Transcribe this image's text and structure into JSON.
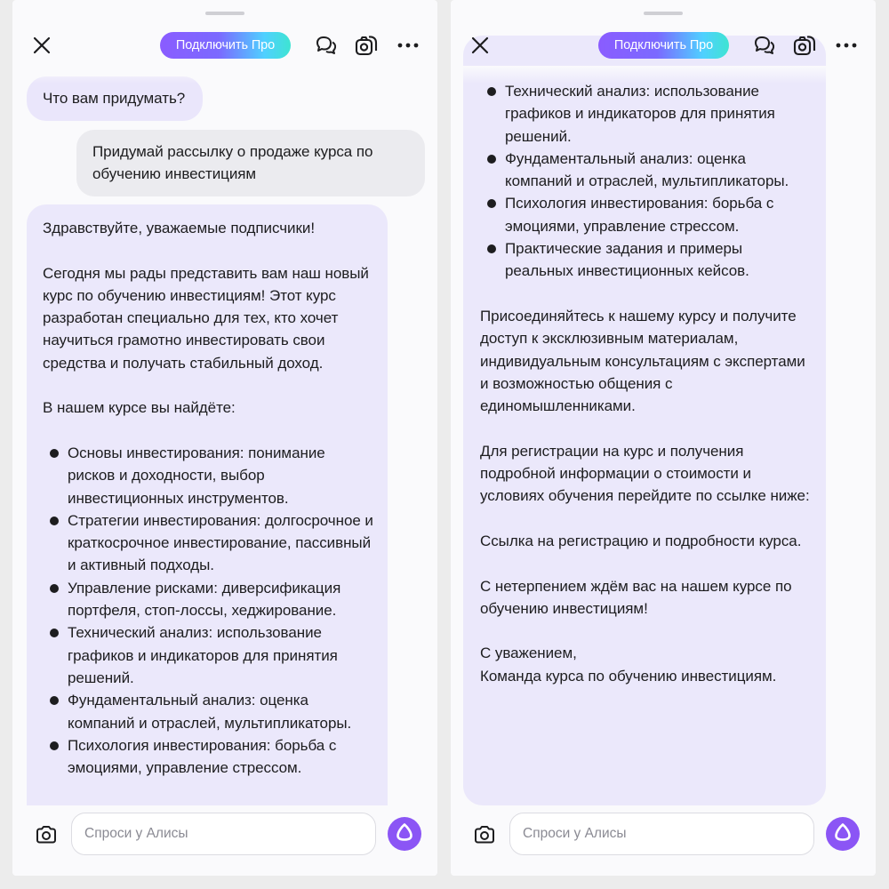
{
  "header": {
    "pro_button_label": "Подключить Про"
  },
  "input": {
    "placeholder": "Спроси у Алисы"
  },
  "left": {
    "alice_greeting": "Что вам придумать?",
    "user_message": "Придумай рассылку о продаже курса по обучению инвестициям",
    "reply": {
      "p1": "Здравствуйте, уважаемые подписчики!",
      "p2": "Сегодня мы рады представить вам наш новый курс по обучению инвестициям! Этот курс разработан специально для тех, кто хочет научиться грамотно инвестировать свои средства и получать стабильный доход.",
      "p3": "В нашем курсе вы найдёте:",
      "bullets": [
        "Основы инвестирования: понимание рисков и доходности, выбор инвестиционных инструментов.",
        "Стратегии инвестирования: долгосрочное и краткосрочное инвестирование, пассивный и активный подходы.",
        "Управление рисками: диверсификация портфеля, стоп-лоссы, хеджирование.",
        "Технический анализ: использование графиков и индикаторов для принятия решений.",
        "Фундаментальный анализ: оценка компаний и отраслей, мультипликаторы.",
        "Психология инвестирования: борьба с эмоциями, управление стрессом."
      ]
    }
  },
  "right": {
    "bullets": [
      "Технический анализ: использование графиков и индикаторов для принятия решений.",
      "Фундаментальный анализ: оценка компаний и отраслей, мультипликаторы.",
      "Психология инвестирования: борьба с эмоциями, управление стрессом.",
      "Практические задания и примеры реальных инвестиционных кейсов."
    ],
    "p_join": "Присоединяйтесь к нашему курсу и получите доступ к эксклюзивным материалам, индивидуальным консультациям с экспертами и возможностью общения с единомышленниками.",
    "p_register": "Для регистрации на курс и получения подробной информации о стоимости и условиях обучения перейдите по ссылке ниже:",
    "p_link": "Ссылка на регистрацию и подробности курса.",
    "p_wait": "С нетерпением ждём вас на нашем курсе по обучению инвестициям!",
    "sign_1": "С уважением,",
    "sign_2": "Команда курса по обучению инвестициям."
  },
  "colors": {
    "accent": "#8b55f5",
    "alice_bubble": "#ebe8fb",
    "user_bubble": "#ebebef"
  },
  "icons": [
    "close-icon",
    "chat-icon",
    "camera-chat-icon",
    "more-icon",
    "camera-icon",
    "alice-icon"
  ]
}
